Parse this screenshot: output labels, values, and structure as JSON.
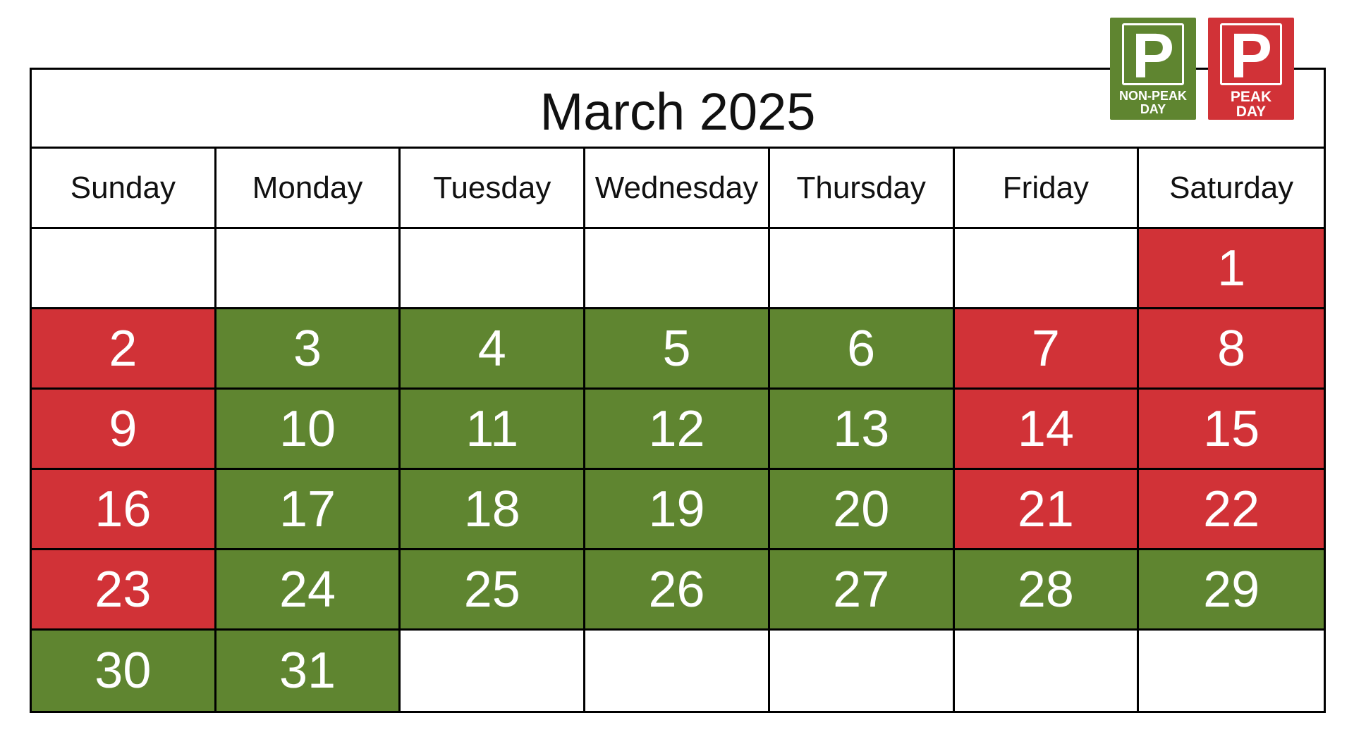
{
  "title": "March 2025",
  "colors": {
    "peak": "#d13237",
    "non_peak": "#5f8530"
  },
  "legend": [
    {
      "type": "non_peak",
      "letter": "P",
      "label_line1": "NON-PEAK",
      "label_line2": "DAY"
    },
    {
      "type": "peak",
      "letter": "P",
      "label_line1": "PEAK",
      "label_line2": "DAY"
    }
  ],
  "weekdays": [
    "Sunday",
    "Monday",
    "Tuesday",
    "Wednesday",
    "Thursday",
    "Friday",
    "Saturday"
  ],
  "days": [
    {
      "day": "",
      "type": "empty"
    },
    {
      "day": "",
      "type": "empty"
    },
    {
      "day": "",
      "type": "empty"
    },
    {
      "day": "",
      "type": "empty"
    },
    {
      "day": "",
      "type": "empty"
    },
    {
      "day": "",
      "type": "empty"
    },
    {
      "day": "1",
      "type": "peak"
    },
    {
      "day": "2",
      "type": "peak"
    },
    {
      "day": "3",
      "type": "nonpeak"
    },
    {
      "day": "4",
      "type": "nonpeak"
    },
    {
      "day": "5",
      "type": "nonpeak"
    },
    {
      "day": "6",
      "type": "nonpeak"
    },
    {
      "day": "7",
      "type": "peak"
    },
    {
      "day": "8",
      "type": "peak"
    },
    {
      "day": "9",
      "type": "peak"
    },
    {
      "day": "10",
      "type": "nonpeak"
    },
    {
      "day": "11",
      "type": "nonpeak"
    },
    {
      "day": "12",
      "type": "nonpeak"
    },
    {
      "day": "13",
      "type": "nonpeak"
    },
    {
      "day": "14",
      "type": "peak"
    },
    {
      "day": "15",
      "type": "peak"
    },
    {
      "day": "16",
      "type": "peak"
    },
    {
      "day": "17",
      "type": "nonpeak"
    },
    {
      "day": "18",
      "type": "nonpeak"
    },
    {
      "day": "19",
      "type": "nonpeak"
    },
    {
      "day": "20",
      "type": "nonpeak"
    },
    {
      "day": "21",
      "type": "peak"
    },
    {
      "day": "22",
      "type": "peak"
    },
    {
      "day": "23",
      "type": "peak"
    },
    {
      "day": "24",
      "type": "nonpeak"
    },
    {
      "day": "25",
      "type": "nonpeak"
    },
    {
      "day": "26",
      "type": "nonpeak"
    },
    {
      "day": "27",
      "type": "nonpeak"
    },
    {
      "day": "28",
      "type": "nonpeak"
    },
    {
      "day": "29",
      "type": "nonpeak"
    },
    {
      "day": "30",
      "type": "nonpeak"
    },
    {
      "day": "31",
      "type": "nonpeak"
    },
    {
      "day": "",
      "type": "empty"
    },
    {
      "day": "",
      "type": "empty"
    },
    {
      "day": "",
      "type": "empty"
    },
    {
      "day": "",
      "type": "empty"
    },
    {
      "day": "",
      "type": "empty"
    }
  ]
}
